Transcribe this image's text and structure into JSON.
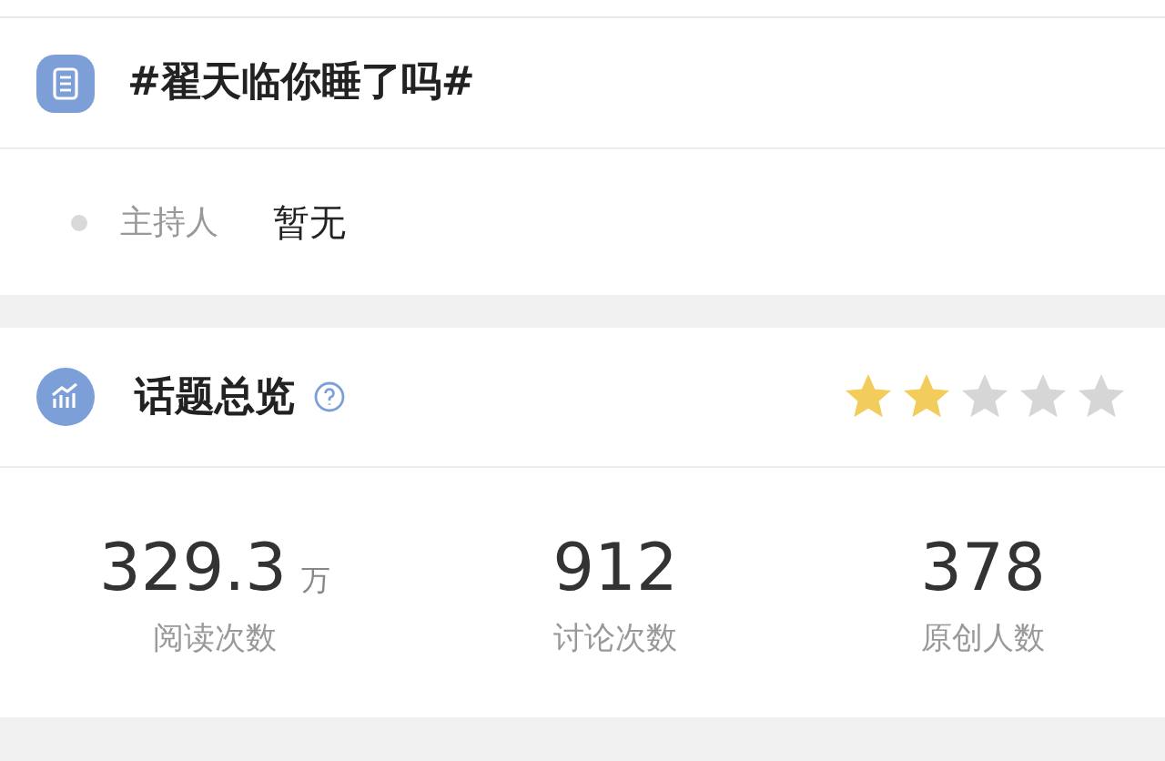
{
  "topic": {
    "title": "#翟天临你睡了吗#",
    "host_label": "主持人",
    "host_value": "暂无"
  },
  "overview": {
    "title": "话题总览",
    "stars": 2,
    "stats": [
      {
        "value": "329.3",
        "unit": "万",
        "label": "阅读次数"
      },
      {
        "value": "912",
        "label": "讨论次数"
      },
      {
        "value": "378",
        "label": "原创人数"
      }
    ]
  }
}
